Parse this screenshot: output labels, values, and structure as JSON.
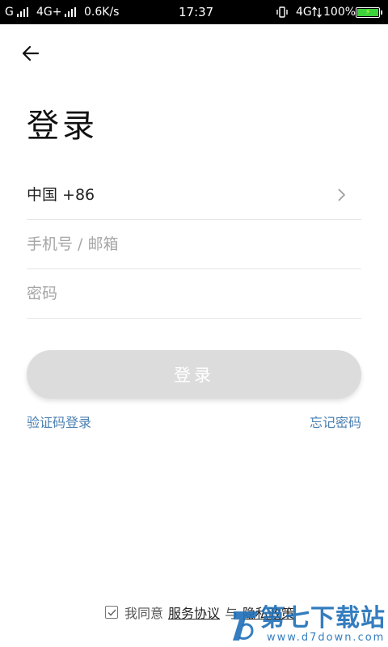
{
  "status_bar": {
    "carrier1": "G",
    "carrier2": "4G+",
    "speed": "0.6K/s",
    "time": "17:37",
    "network_right": "4G",
    "battery": "100%"
  },
  "page": {
    "title": "登录"
  },
  "form": {
    "country_code": "中国 +86",
    "account_placeholder": "手机号 / 邮箱",
    "password_placeholder": "密码",
    "login_label": "登录"
  },
  "links": {
    "sms_login": "验证码登录",
    "forgot_password": "忘记密码"
  },
  "agreement": {
    "prefix": "我同意",
    "service": "服务协议",
    "separator": "与",
    "privacy": "隐私政策"
  },
  "watermark": {
    "name": "第七下载站",
    "url": "www.d7down.com"
  },
  "colors": {
    "link": "#4a7fb0",
    "button_disabled": "#dcdcdc",
    "battery": "#3cd23c"
  }
}
